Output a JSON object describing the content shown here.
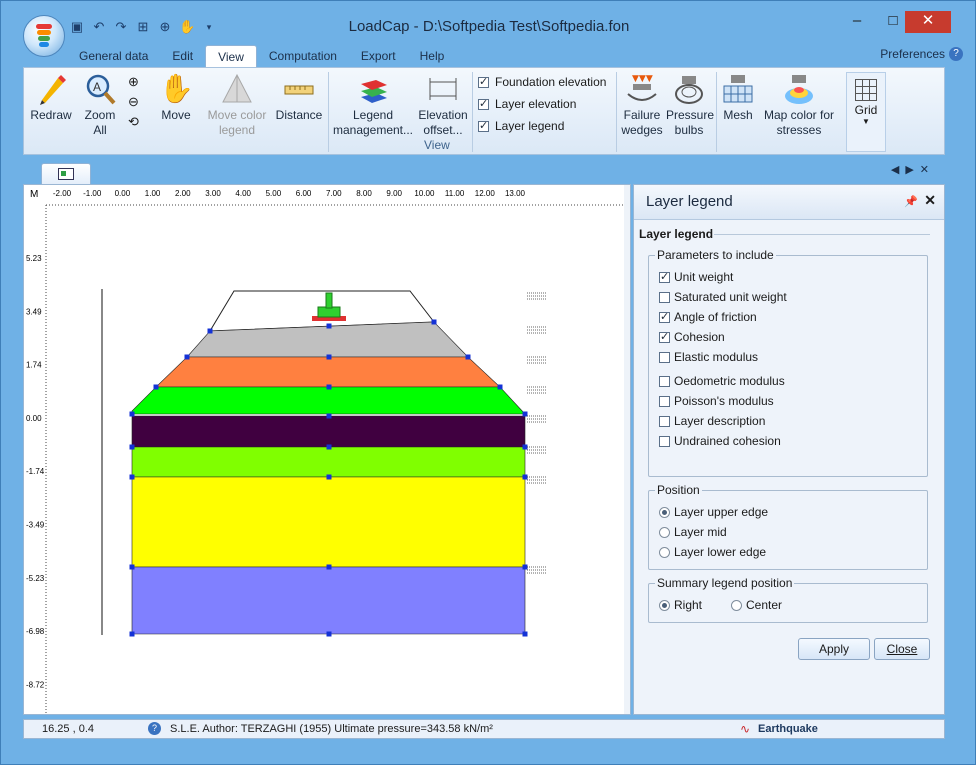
{
  "window": {
    "title": "LoadCap  - D:\\Softpedia Test\\Softpedia.fon",
    "minimize": "–",
    "maximize": "□",
    "close": "✕"
  },
  "tabs": [
    "General data",
    "Edit",
    "View",
    "Computation",
    "Export",
    "Help"
  ],
  "active_tab": "View",
  "preferences_label": "Preferences",
  "ribbon": {
    "redraw": "Redraw",
    "zoom_all": "Zoom All",
    "move": "Move",
    "move_color_legend": "Move color legend",
    "distance": "Distance",
    "legend_management": "Legend management...",
    "elevation_offset": "Elevation offset...",
    "checks": [
      {
        "label": "Foundation elevation",
        "checked": true
      },
      {
        "label": "Layer elevation",
        "checked": true
      },
      {
        "label": "Layer legend",
        "checked": true
      }
    ],
    "failure_wedges": "Failure wedges",
    "pressure_bulbs": "Pressure bulbs",
    "mesh": "Mesh",
    "map_color_stresses": "Map color for stresses",
    "grid": "Grid",
    "group_label": "View"
  },
  "ruler": {
    "corner": "M",
    "x_ticks": [
      "-2.00",
      "-1.00",
      "0.00",
      "1.00",
      "2.00",
      "3.00",
      "4.00",
      "5.00",
      "6.00",
      "7.00",
      "8.00",
      "9.00",
      "10.00",
      "11.00",
      "12.00",
      "13.00"
    ],
    "y_ticks": [
      "5.23",
      "3.49",
      "1.74",
      "0.00",
      "-1.74",
      "-3.49",
      "-5.23",
      "-6.98",
      "-8.72"
    ]
  },
  "layers": [
    {
      "color": "#c0c0c0"
    },
    {
      "color": "#ff8040"
    },
    {
      "color": "#00ff00"
    },
    {
      "color": "#400040"
    },
    {
      "color": "#80ff00"
    },
    {
      "color": "#ffff00"
    },
    {
      "color": "#8080ff"
    }
  ],
  "panel": {
    "title": "Layer legend",
    "subtitle": "Layer legend",
    "parameters_label": "Parameters to include",
    "parameters": [
      {
        "label": "Unit weight",
        "checked": true
      },
      {
        "label": "Saturated unit weight",
        "checked": false
      },
      {
        "label": "Angle of friction",
        "checked": true
      },
      {
        "label": "Cohesion",
        "checked": true
      },
      {
        "label": "Elastic modulus",
        "checked": false
      },
      {
        "label": "Oedometric modulus",
        "checked": false
      },
      {
        "label": "Poisson's modulus",
        "checked": false
      },
      {
        "label": "Layer description",
        "checked": false
      },
      {
        "label": "Undrained cohesion",
        "checked": false
      }
    ],
    "position_label": "Position",
    "positions": [
      {
        "label": "Layer upper edge",
        "selected": true
      },
      {
        "label": "Layer mid",
        "selected": false
      },
      {
        "label": "Layer lower edge",
        "selected": false
      }
    ],
    "summary_label": "Summary legend position",
    "summary_options": [
      {
        "label": "Right",
        "selected": true
      },
      {
        "label": "Center",
        "selected": false
      }
    ],
    "apply": "Apply",
    "close": "Close"
  },
  "status": {
    "coords": "16.25 , 0.4",
    "message": "S.L.E. Author: TERZAGHI (1955) Ultimate pressure=343.58 kN/m²",
    "earthquake": "Earthquake"
  }
}
